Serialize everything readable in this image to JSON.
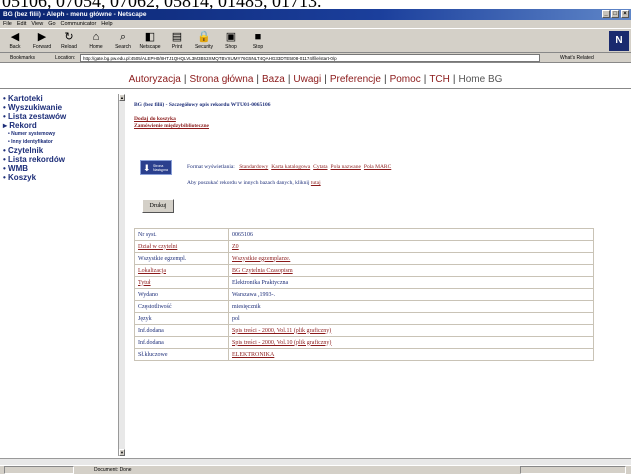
{
  "top_cut_text": "05106, 07054, 07062, 05814, 01485, 01713.",
  "browser": {
    "title": "BG (bez filii) - Aleph - menu główne - Netscape",
    "menu": [
      "File",
      "Edit",
      "View",
      "Go",
      "Communicator",
      "Help"
    ],
    "toolbar": [
      {
        "label": "Back",
        "icon": "back-arrow-icon"
      },
      {
        "label": "Forward",
        "icon": "forward-arrow-icon"
      },
      {
        "label": "Reload",
        "icon": "reload-icon"
      },
      {
        "label": "Home",
        "icon": "home-icon"
      },
      {
        "label": "Search",
        "icon": "search-icon"
      },
      {
        "label": "Netscape",
        "icon": "netscape-icon"
      },
      {
        "label": "Print",
        "icon": "print-icon"
      },
      {
        "label": "Security",
        "icon": "security-icon"
      },
      {
        "label": "Shop",
        "icon": "shop-icon"
      },
      {
        "label": "Stop",
        "icon": "stop-icon"
      }
    ],
    "bookmarks_label": "Bookmarks",
    "location_label": "Location:",
    "url": "http://gate.bg.pw.edu.pl:4505/ALEPH0/8HTJ1QHQLVL3M3B53XMQTBVXUMY76G5NLT4QAHG33DTE5I08-01174/file/start-0/p",
    "related_label": "What's Related",
    "netscape_logo": "N",
    "status_text": "Document: Done"
  },
  "topnav": {
    "items": [
      "Autoryzacja",
      "Strona główna",
      "Baza",
      "Uwagi",
      "Preferencje",
      "Pomoc",
      "TCH"
    ],
    "current": "Home BG",
    "separator": "|"
  },
  "sidebar": {
    "items": [
      {
        "label": "Kartoteki",
        "bullet": "•"
      },
      {
        "label": "Wyszukiwanie",
        "bullet": "•"
      },
      {
        "label": "Lista zestawów",
        "bullet": "•"
      },
      {
        "label": "Rekord",
        "bullet": "▸"
      }
    ],
    "sub_items": [
      {
        "label": "Numer systemowy",
        "bullet": "•"
      },
      {
        "label": "Inny identyfikator",
        "bullet": "•"
      }
    ],
    "items2": [
      {
        "label": "Czytelnik",
        "bullet": "•"
      },
      {
        "label": "Lista rekordów",
        "bullet": "•"
      },
      {
        "label": "WMB",
        "bullet": "•"
      },
      {
        "label": "Koszyk",
        "bullet": "•"
      }
    ]
  },
  "content": {
    "record_title": "BG (bez filii) - Szczegółowy opis rekordu WTU01-0065106",
    "add_to_basket": "Dodaj do koszyka",
    "interlibrary": "Zamówienie międzybiblioteczne",
    "strona_btn_label": "Strona Następna",
    "format_prefix": "Format wyświetlania:",
    "formats": [
      "Standardowy",
      "Karta katalogowa",
      "Cytata",
      "Pola nazwane",
      "Pola MARC"
    ],
    "other_bases_text": "Aby poszukać rekordu w innych bazach danych, kliknij",
    "other_bases_link": "tutaj",
    "print_button": "Drukuj"
  },
  "record_rows": [
    {
      "label": "Nr syst.",
      "label_link": false,
      "value": "0065106",
      "value_link": false
    },
    {
      "label": "Dział w czytelni",
      "label_link": true,
      "value": "Z0",
      "value_link": true
    },
    {
      "label": "Wszystkie egzempl.",
      "label_link": false,
      "value": "Wszystkie egzemplarze.",
      "value_link": true
    },
    {
      "label": "Lokalizacja",
      "label_link": true,
      "value": "BG Czytelnia Czasopism",
      "value_link": true
    },
    {
      "label": "Tytuł",
      "label_link": true,
      "value": "Elektronika Praktyczna",
      "value_link": false
    },
    {
      "label": "Wydano",
      "label_link": false,
      "value": "Warszawa ,1993-.",
      "value_link": false
    },
    {
      "label": "Częstotliwość",
      "label_link": false,
      "value": "miesięcznik",
      "value_link": false
    },
    {
      "label": "Język",
      "label_link": false,
      "value": "pol",
      "value_link": false
    },
    {
      "label": "Inf.dodana",
      "label_link": false,
      "value": "Spis treści - 2000, Vol.11 (plik graficzny)",
      "value_link": true
    },
    {
      "label": "Inf.dodana",
      "label_link": false,
      "value": "Spis treści - 2000, Vol.10 (plik graficzny)",
      "value_link": true
    },
    {
      "label": "Sł.kluczowe",
      "label_link": false,
      "value": "ELEKTRONIKA",
      "value_link": true
    }
  ],
  "colors": {
    "link_red": "#8b1a1a",
    "text_blue": "#1c2d78",
    "chrome_gray": "#d4d0c8",
    "title_blue": "#0a2470"
  }
}
